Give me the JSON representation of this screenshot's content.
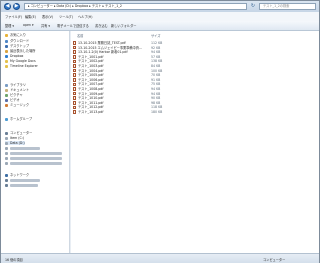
{
  "address": {
    "back": "◀",
    "forward": "▶",
    "path": "▸ コンピューター ▸ Data (D:) ▸ Dropbox ▸ テスト ▸ テスト_1_2",
    "refresh": "↻",
    "search_placeholder": "テスト_1_2の検索"
  },
  "menu": [
    "ファイル(F)",
    "編集(E)",
    "表示(V)",
    "ツール(T)",
    "ヘルプ(H)"
  ],
  "toolbar": {
    "organize": "整理 ▾",
    "open": "open ▾",
    "share": "共有 ▾",
    "email": "電子メールで送信する",
    "burn": "書き込む",
    "new_folder": "新しいフォルダー"
  },
  "sidebar": {
    "favorites_header": "お気に入り",
    "favorites": [
      "ダウンロード",
      "デスクトップ",
      "最近表示した場所",
      "Dropbox",
      "My Google Docs",
      "Timeline Explorer"
    ],
    "libraries_header": "ライブラリ",
    "libraries": [
      "ドキュメント",
      "ピクチャ",
      "ビデオ",
      "ミュージック"
    ],
    "homegroup": "ホームグループ",
    "computer_header": "コンピューター",
    "drives": [
      "Item (C:)",
      "Data (D:)"
    ],
    "network_header": "ネットワーク"
  },
  "columns": {
    "name": "名前",
    "size": "サイズ"
  },
  "files": [
    {
      "name": "13-10-2015 業務日誌_TEST.pdf",
      "size": "112 KB"
    },
    {
      "name": "13-10-2015 エムジェイピー事業準備中資...",
      "size": "92 KB"
    },
    {
      "name": "13-10-1.2(0) Harbor 新着01.pdf",
      "size": "94 KB"
    },
    {
      "name": "テスト_1001.pdf",
      "size": "57 KB"
    },
    {
      "name": "テスト_1002.pdf",
      "size": "138 KB"
    },
    {
      "name": "テスト_1003.pdf",
      "size": "84 KB"
    },
    {
      "name": "テスト_1004.pdf",
      "size": "100 KB"
    },
    {
      "name": "テスト_1005.pdf",
      "size": "70 KB"
    },
    {
      "name": "テスト_1006.pdf",
      "size": "91 KB"
    },
    {
      "name": "テスト_1007.pdf",
      "size": "75 KB"
    },
    {
      "name": "テスト_1008.pdf",
      "size": "94 KB"
    },
    {
      "name": "テスト_1009.pdf",
      "size": "94 KB"
    },
    {
      "name": "テスト_1010.pdf",
      "size": "90 KB"
    },
    {
      "name": "テスト_1011.pdf",
      "size": "98 KB"
    },
    {
      "name": "テスト_1012.pdf",
      "size": "118 KB"
    },
    {
      "name": "テスト_1013.pdf",
      "size": "180 KB"
    }
  ],
  "status": {
    "items": "16 個の項目",
    "location": "コンピューター"
  }
}
